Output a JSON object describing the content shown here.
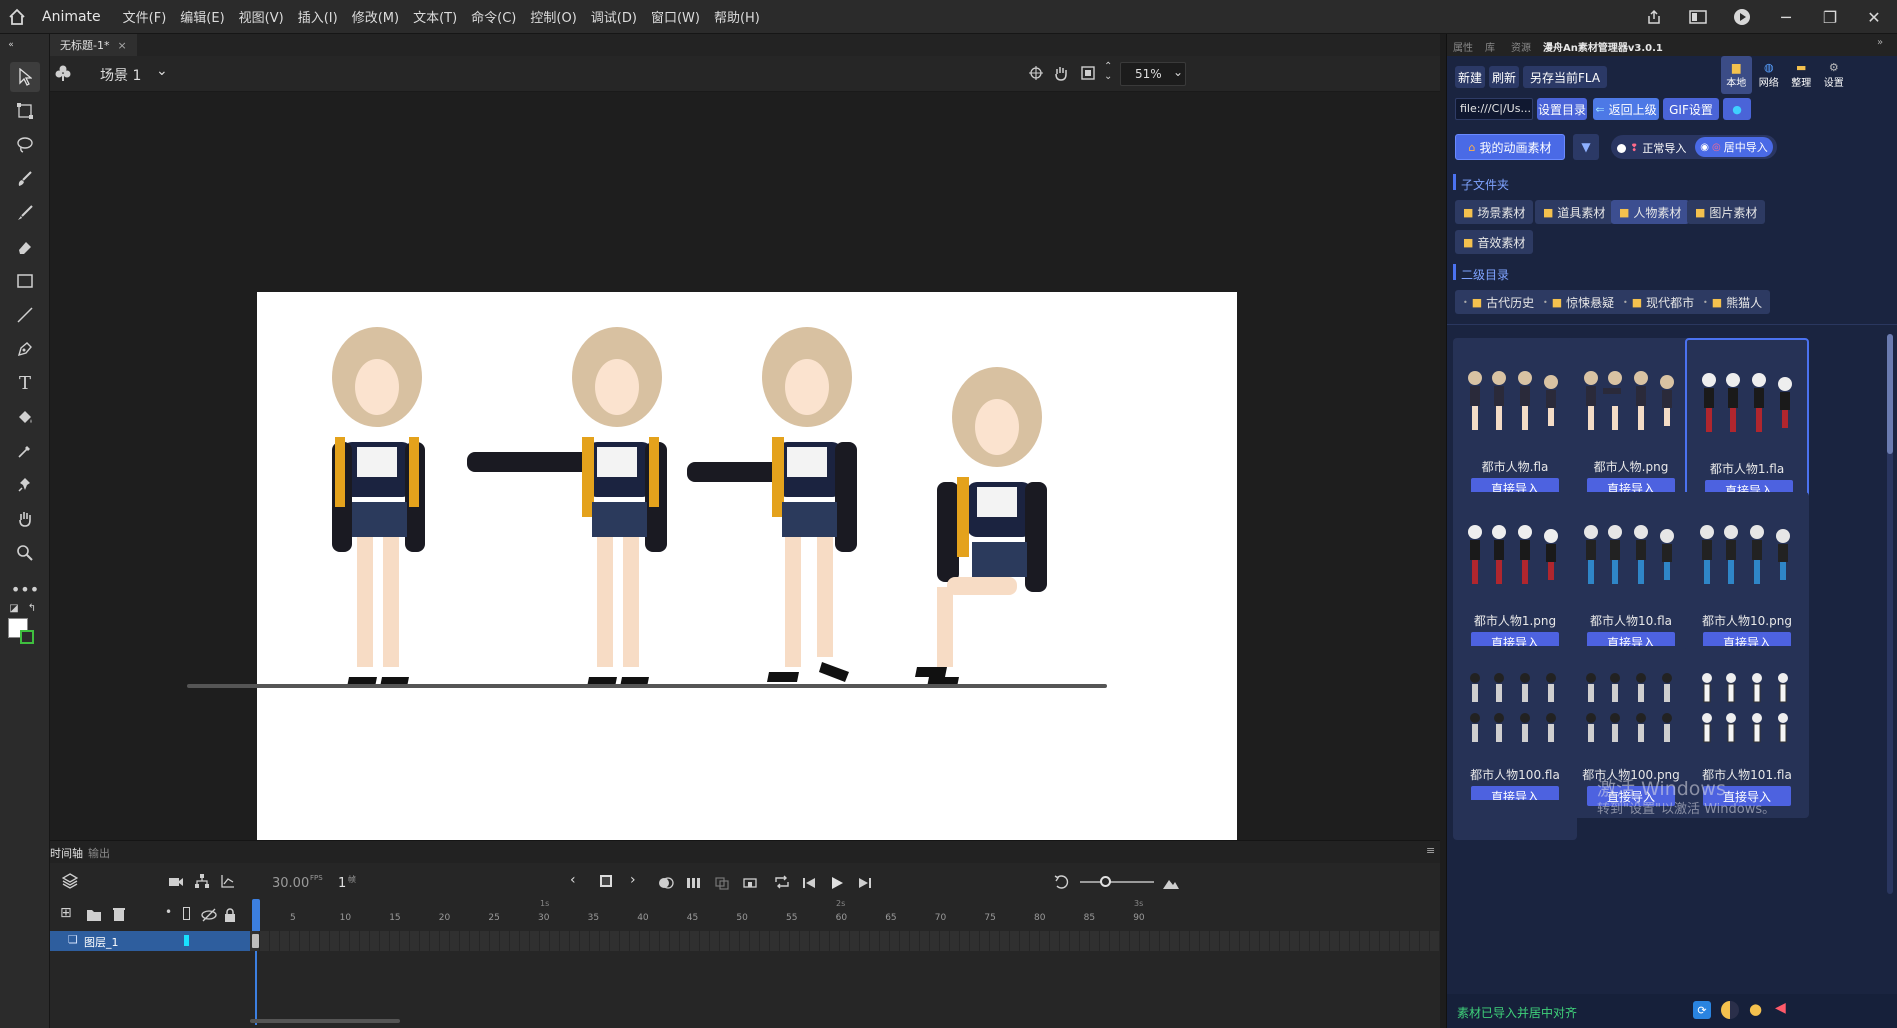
{
  "menubar": {
    "app_name": "Animate",
    "menus": [
      "文件(F)",
      "编辑(E)",
      "视图(V)",
      "插入(I)",
      "修改(M)",
      "文本(T)",
      "命令(C)",
      "控制(O)",
      "调试(D)",
      "窗口(W)",
      "帮助(H)"
    ]
  },
  "document": {
    "tab_title": "无标题-1*",
    "close_glyph": "×"
  },
  "scene": {
    "name": "场景 1",
    "zoom": "51%"
  },
  "timeline": {
    "tabs": [
      "时间轴",
      "输出"
    ],
    "fps": "30.00",
    "fps_unit": "FPS",
    "frame": "1",
    "frame_unit": "帧",
    "seconds": [
      "1s",
      "2s",
      "3s"
    ],
    "frame_numbers": [
      "5",
      "10",
      "15",
      "20",
      "25",
      "30",
      "35",
      "40",
      "45",
      "50",
      "55",
      "60",
      "65",
      "70",
      "75",
      "80",
      "85",
      "90"
    ],
    "layer_name": "图层_1"
  },
  "rightpanel": {
    "tabs": [
      "属性",
      "库",
      "资源",
      "漫舟An素材管理器v3.0.1"
    ],
    "buttons": {
      "new": "新建",
      "refresh": "刷新",
      "save_fla": "另存当前FLA",
      "set_dir": "设置目录",
      "go_up": "返回上级",
      "gif": "GIF设置"
    },
    "mode_tabs": [
      "本地",
      "网络",
      "整理",
      "设置"
    ],
    "path": "file:///C|/Us...",
    "my_assets": "我的动画素材",
    "import_normal": "正常导入",
    "import_center": "居中导入",
    "subfolder_label": "子文件夹",
    "subfolders": [
      "场景素材",
      "道具素材",
      "人物素材",
      "图片素材",
      "音效素材"
    ],
    "second_label": "二级目录",
    "second_dirs": [
      "古代历史",
      "惊悚悬疑",
      "现代都市",
      "熊猫人"
    ],
    "cards": [
      {
        "name": "都市人物.fla",
        "btn": "直接导入"
      },
      {
        "name": "都市人物.png",
        "btn": "直接导入"
      },
      {
        "name": "都市人物1.fla",
        "btn": "直接导入"
      },
      {
        "name": "都市人物1.png",
        "btn": "直接导入"
      },
      {
        "name": "都市人物10.fla",
        "btn": "直接导入"
      },
      {
        "name": "都市人物10.png",
        "btn": "直接导入"
      },
      {
        "name": "都市人物100.fla",
        "btn": "直接导入"
      },
      {
        "name": "都市人物100.png",
        "btn": "直接导入"
      },
      {
        "name": "都市人物101.fla",
        "btn": "直接导入"
      }
    ],
    "status": "素材已导入并居中对齐",
    "watermark_title": "激活 Windows",
    "watermark_sub": "转到\"设置\"以激活 Windows。"
  }
}
